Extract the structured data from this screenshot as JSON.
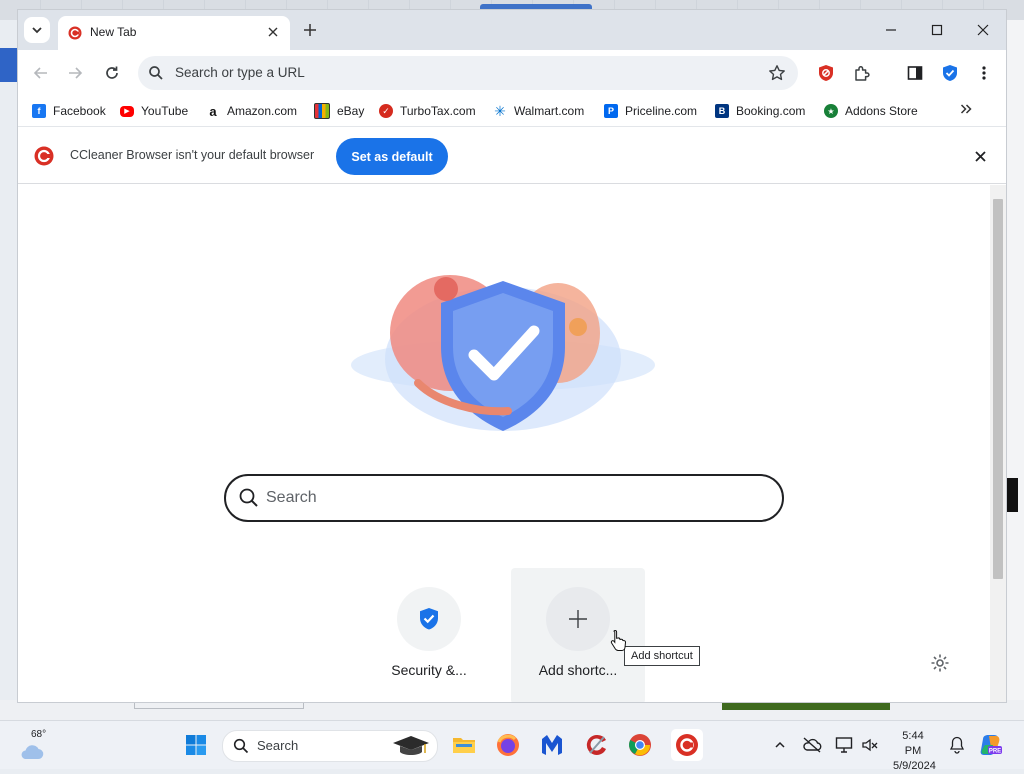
{
  "browser": {
    "tab": {
      "title": "New Tab"
    },
    "address_bar": {
      "placeholder": "Search or type a URL",
      "value": ""
    },
    "bookmarks": [
      {
        "label": "Facebook",
        "icon": "facebook-icon"
      },
      {
        "label": "YouTube",
        "icon": "youtube-icon"
      },
      {
        "label": "Amazon.com",
        "icon": "amazon-icon"
      },
      {
        "label": "eBay",
        "icon": "ebay-icon"
      },
      {
        "label": "TurboTax.com",
        "icon": "turbotax-icon"
      },
      {
        "label": "Walmart.com",
        "icon": "walmart-icon"
      },
      {
        "label": "Priceline.com",
        "icon": "priceline-icon"
      },
      {
        "label": "Booking.com",
        "icon": "booking-icon"
      },
      {
        "label": "Addons Store",
        "icon": "addons-store-icon"
      }
    ],
    "infobar": {
      "message": "CCleaner Browser isn't your default browser",
      "button_label": "Set as default"
    }
  },
  "new_tab_page": {
    "search_placeholder": "Search",
    "shortcuts": [
      {
        "label": "Security &...",
        "icon": "shield-check-icon"
      },
      {
        "label": "Add shortc...",
        "icon": "plus-icon"
      }
    ],
    "tooltip": "Add shortcut"
  },
  "taskbar": {
    "weather": {
      "temperature": "68°",
      "icon": "cloud-icon"
    },
    "search_label": "Search",
    "clock": {
      "time": "5:44 PM",
      "date": "5/9/2024"
    }
  },
  "colors": {
    "accent": "#1a73e8",
    "ccleaner_red": "#d93025",
    "tabstrip": "#dee3ea"
  }
}
